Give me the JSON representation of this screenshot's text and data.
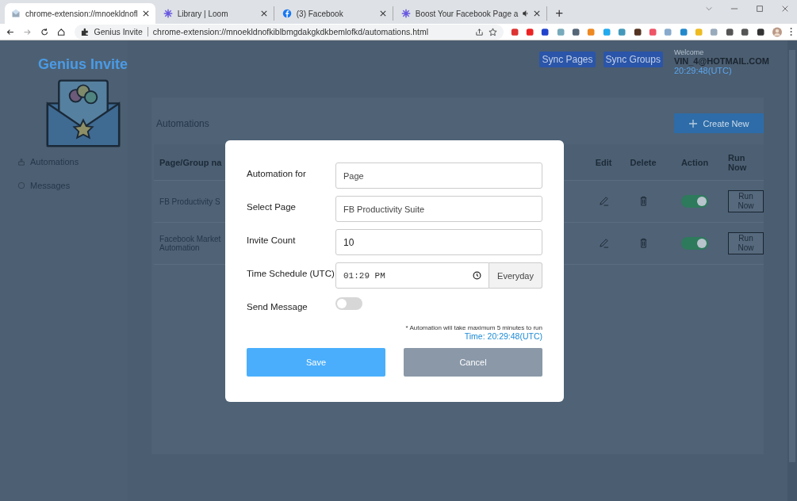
{
  "browser": {
    "tabs": [
      {
        "title": "chrome-extension://mnoekldnofl",
        "selected": true,
        "audio": false
      },
      {
        "title": "Library | Loom",
        "selected": false,
        "audio": false
      },
      {
        "title": "(3) Facebook",
        "selected": false,
        "audio": false
      },
      {
        "title": "Boost Your Facebook Page a",
        "selected": false,
        "audio": true
      }
    ],
    "new_tab": "+",
    "site_name": "Genius Invite",
    "url": "chrome-extension://mnoekldnofkiblbmgdakgkdkbemlofkd/automations.html"
  },
  "sidebar": {
    "brand": "Genius Invite",
    "items": [
      {
        "label": "Automations"
      },
      {
        "label": "Messages"
      }
    ]
  },
  "header": {
    "buttons": [
      "Sync Pages",
      "Sync Groups"
    ],
    "welcome": "Welcome",
    "user": "VIN_4@HOTMAIL.COM",
    "time": "20:29:48(UTC)"
  },
  "main": {
    "title": "Automations",
    "create_button": "Create New",
    "columns": [
      "Page/Group na",
      "Edit",
      "Delete",
      "Action",
      "Run Now"
    ],
    "rows": [
      {
        "name": "FB Productivity S",
        "on": true,
        "run": "Run Now"
      },
      {
        "name": "Facebook Market Automation",
        "on": true,
        "run": "Run Now"
      }
    ]
  },
  "modal": {
    "fields": [
      {
        "label": "Automation for",
        "kind": "text",
        "value": "Page"
      },
      {
        "label": "Select Page",
        "kind": "text",
        "value": "FB Productivity Suite"
      },
      {
        "label": "Invite Count",
        "kind": "number",
        "value": "10"
      },
      {
        "label": "Time Schedule (UTC)",
        "kind": "time",
        "value": "01:29 PM",
        "addon": "Everyday"
      },
      {
        "label": "Send Message",
        "kind": "toggle",
        "on": false
      }
    ],
    "note": "* Automation will take maximum 5 minutes to run",
    "time": "Time: 20:29:48(UTC)",
    "buttons": [
      {
        "label": "Save",
        "kind": "primary"
      },
      {
        "label": "Cancel",
        "kind": "secondary"
      }
    ]
  }
}
